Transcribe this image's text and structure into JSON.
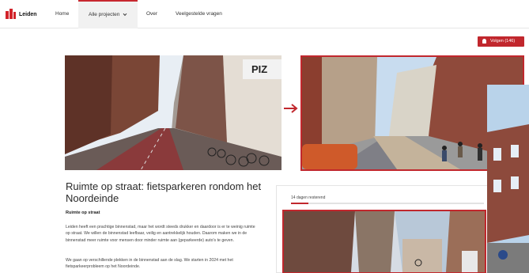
{
  "nav": {
    "logo_text": "Leiden",
    "items": [
      "Home",
      "Alle projecten",
      "Over",
      "Veelgestelde vragen"
    ],
    "chevron": "chevron-down-icon"
  },
  "follow": {
    "label": "Volgen (146)",
    "icon": "bell-icon"
  },
  "project": {
    "title": "Ruimte op straat: fietsparkeren rondom het Noordeinde",
    "subheading": "Ruimte op straat",
    "paragraphs": [
      "Leiden heeft een prachtige binnenstad, maar het wordt steeds drukker en daardoor is er te weinig ruimte op straat. We willen de binnenstad leefbaar, veilig en aantrekkelijk houden. Daarom maken we in de binnenstad meer ruimte voor mensen door minder ruimte aan (geparkeerde) auto's te geven.",
      "We gaan op verschillende plekken in de binnenstad aan de slag. We starten in 2024 met het fietsparkeerprobleem op het Noordeinde."
    ]
  },
  "status": {
    "days_remaining": "14 dagen resterend",
    "progress": 0.09
  },
  "colors": {
    "accent": "#c1272d",
    "page_bg": "#ffffff",
    "frame_bg": "#dde9f2"
  },
  "images": {
    "before": "photo of current street with parked bicycles",
    "after": "visualisation of redesigned street",
    "card": "street photo with cyclists",
    "arrow": "arrow-right-icon"
  }
}
